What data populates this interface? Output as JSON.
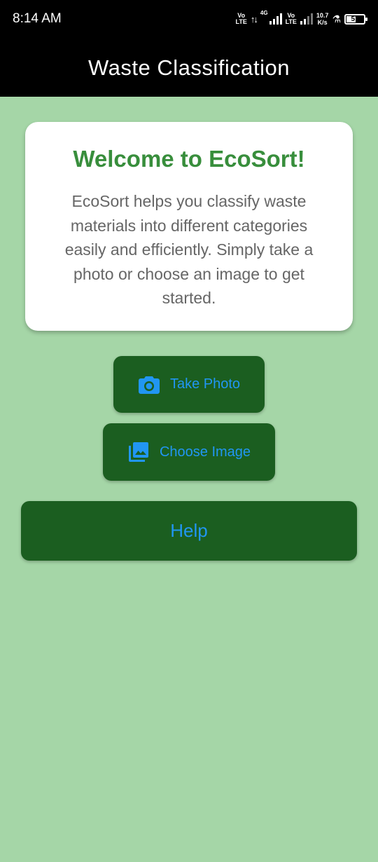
{
  "status_bar": {
    "time": "8:14 AM",
    "vo1_top": "Vo",
    "vo1_bottom": "LTE",
    "net_type": "4G",
    "vo2_top": "Vo",
    "vo2_bottom": "LTE",
    "speed_value": "10.7",
    "speed_unit": "K/s",
    "battery_level": "57",
    "battery_percent": 57,
    "icons": [
      "volte-icon",
      "data-arrows-icon",
      "signal-bars-icon",
      "flask-icon",
      "battery-icon"
    ]
  },
  "app_bar": {
    "title": "Waste Classification"
  },
  "welcome_card": {
    "title": "Welcome to EcoSort!",
    "body": "EcoSort helps you classify waste materials into different categories easily and efficiently. Simply take a photo or choose an image to get started."
  },
  "actions": {
    "take_photo": {
      "label": "Take Photo",
      "icon": "camera-icon"
    },
    "choose_image": {
      "label": "Choose Image",
      "icon": "photo-library-icon"
    },
    "help": {
      "label": "Help"
    }
  },
  "colors": {
    "background": "#A5D6A7",
    "app_bar": "#000000",
    "card": "#FFFFFF",
    "title_green": "#388E3C",
    "button_bg": "#1B5E20",
    "button_text": "#2196F3",
    "body_text": "#666666"
  }
}
